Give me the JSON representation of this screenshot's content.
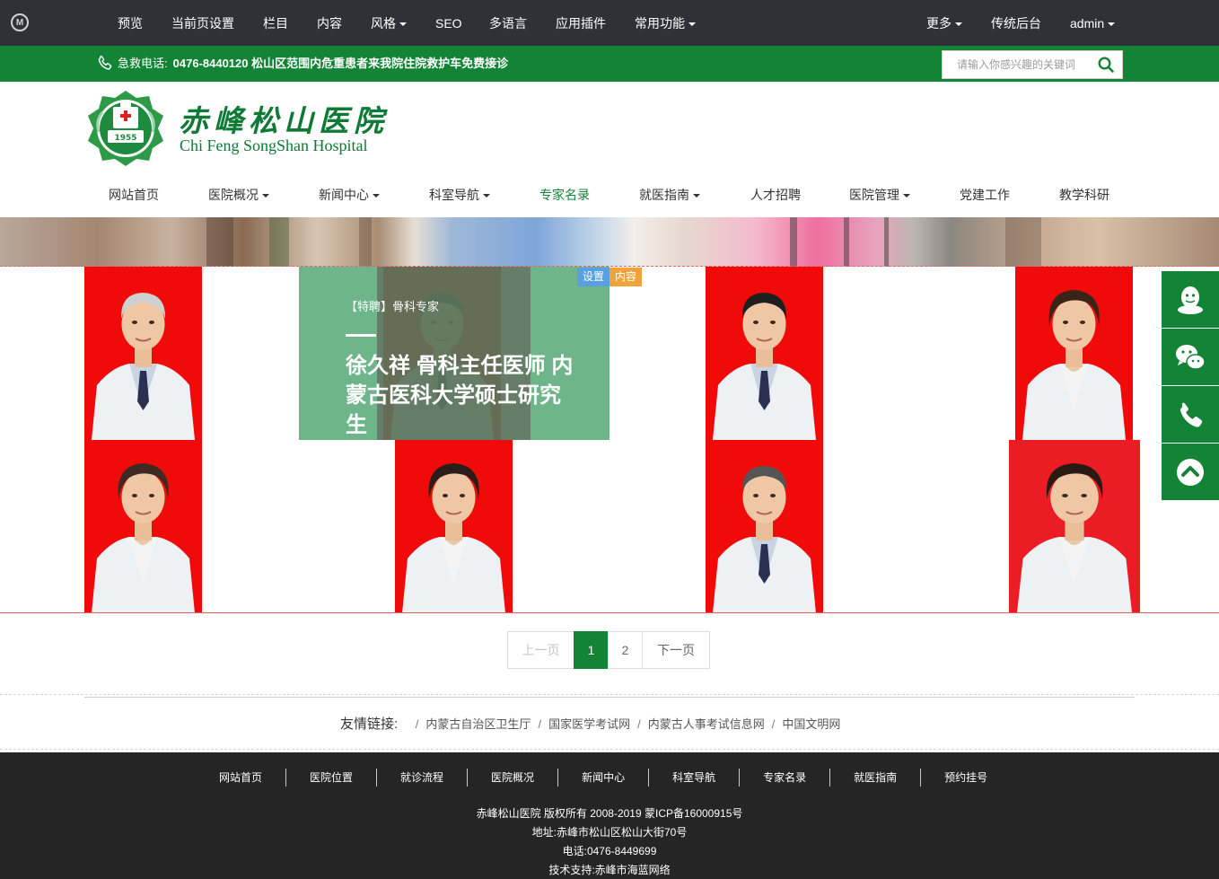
{
  "admin_bar": {
    "logo_letter": "M",
    "left_items": [
      {
        "label": "预览",
        "dropdown": false
      },
      {
        "label": "当前页设置",
        "dropdown": false
      },
      {
        "label": "栏目",
        "dropdown": false
      },
      {
        "label": "内容",
        "dropdown": false
      },
      {
        "label": "风格",
        "dropdown": true
      },
      {
        "label": "SEO",
        "dropdown": false
      },
      {
        "label": "多语言",
        "dropdown": false
      },
      {
        "label": "应用插件",
        "dropdown": false
      },
      {
        "label": "常用功能",
        "dropdown": true
      }
    ],
    "right_items": [
      {
        "label": "更多",
        "dropdown": true
      },
      {
        "label": "传统后台",
        "dropdown": false
      },
      {
        "label": "admin",
        "dropdown": true
      }
    ]
  },
  "top_bar": {
    "phone_label": "急救电话:",
    "phone_text": "0476-8440120 松山区范围内危重患者来我院住院救护车免费接诊",
    "search_placeholder": "请输入你感兴趣的关键词"
  },
  "header": {
    "logo_year": "1955",
    "logo_cn": "赤峰松山医院",
    "logo_en": "Chi Feng SongShan Hospital"
  },
  "main_nav": [
    {
      "label": "网站首页",
      "dropdown": false,
      "active": false
    },
    {
      "label": "医院概况",
      "dropdown": true,
      "active": false
    },
    {
      "label": "新闻中心",
      "dropdown": true,
      "active": false
    },
    {
      "label": "科室导航",
      "dropdown": true,
      "active": false
    },
    {
      "label": "专家名录",
      "dropdown": false,
      "active": true
    },
    {
      "label": "就医指南",
      "dropdown": true,
      "active": false
    },
    {
      "label": "人才招聘",
      "dropdown": false,
      "active": false
    },
    {
      "label": "医院管理",
      "dropdown": true,
      "active": false
    },
    {
      "label": "党建工作",
      "dropdown": false,
      "active": false
    },
    {
      "label": "教学科研",
      "dropdown": false,
      "active": false
    }
  ],
  "expert_overlay": {
    "tag": "【特聘】骨科专家",
    "title": "徐久祥 骨科主任医师 内蒙古医科大学硕士研究生",
    "edit_badges": [
      {
        "label": "设置",
        "color": "#5aa0e0"
      },
      {
        "label": "内容",
        "color": "#f0a33a"
      }
    ]
  },
  "experts": [
    {
      "hair": "#cfcfcf",
      "gender": "male",
      "tie": true,
      "bg": "#f10a0a"
    },
    {
      "hair": "#2b2b2b",
      "gender": "male",
      "tie": true,
      "bg": "#f10a0a"
    },
    {
      "hair": "#1f1f1f",
      "gender": "male",
      "tie": true,
      "bg": "#f10a0a"
    },
    {
      "hair": "#3a2418",
      "gender": "female",
      "tie": false,
      "bg": "#f10a0a"
    },
    {
      "hair": "#3e2a22",
      "gender": "female",
      "tie": false,
      "bg": "#f10a0a"
    },
    {
      "hair": "#2a1e1a",
      "gender": "female",
      "tie": false,
      "bg": "#f10a0a"
    },
    {
      "hair": "#555555",
      "gender": "male",
      "tie": true,
      "bg": "#f10a0a"
    },
    {
      "hair": "#2a1a14",
      "gender": "female",
      "tie": false,
      "bg": "#ec1c24"
    }
  ],
  "pagination": {
    "prev": "上一页",
    "pages": [
      "1",
      "2"
    ],
    "current": "1",
    "next": "下一页"
  },
  "friend_links": {
    "title": "友情链接:",
    "links": [
      "内蒙古自治区卫生厅",
      "国家医学考试网",
      "内蒙古人事考试信息网",
      "中国文明网"
    ]
  },
  "footer": {
    "nav": [
      "网站首页",
      "医院位置",
      "就诊流程",
      "医院概况",
      "新闻中心",
      "科室导航",
      "专家名录",
      "就医指南",
      "预约挂号"
    ],
    "copyright": "赤峰松山医院 版权所有 2008-2019 蒙ICP备16000915号",
    "address": "地址:赤峰市松山区松山大街70号",
    "phone": "电话:0476-8449699",
    "support": "技术支持:赤峰市海蓝网络"
  },
  "float_bar": [
    "qq-icon",
    "wechat-icon",
    "phone-icon",
    "back-to-top-icon"
  ],
  "colors": {
    "brand_green": "#138436",
    "admin_bg": "#2e3238",
    "footer_bg": "#252525"
  }
}
